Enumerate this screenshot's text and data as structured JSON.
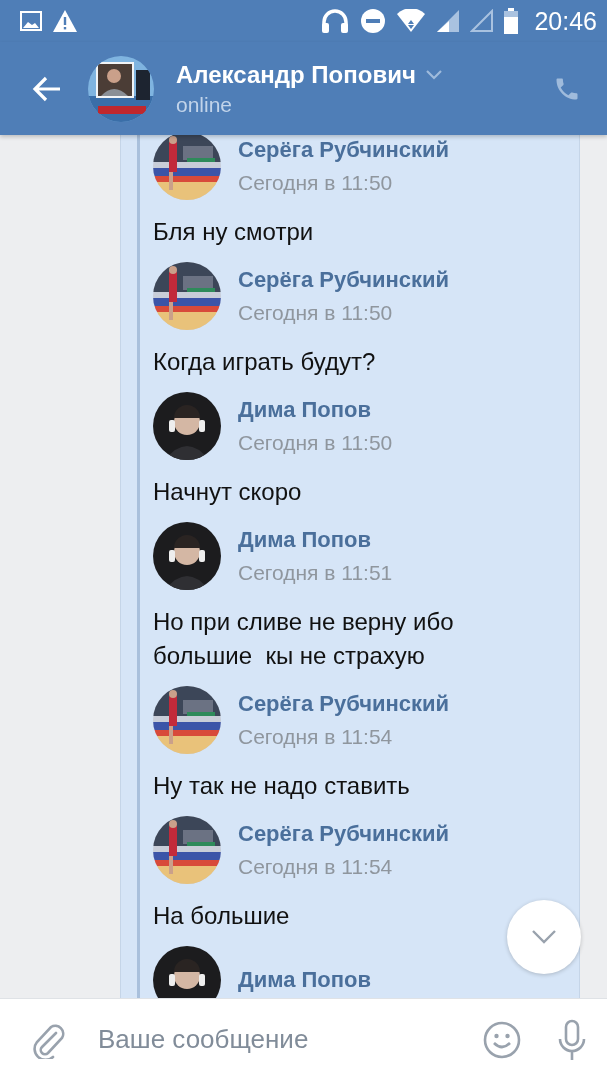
{
  "status_bar": {
    "time": "20:46"
  },
  "header": {
    "name": "Александр Попович",
    "status": "online"
  },
  "messages": [
    {
      "author": "Серёга Рубчинский",
      "time": "Сегодня в 11:50",
      "text": "Бля ну смотри"
    },
    {
      "author": "Серёга Рубчинский",
      "time": "Сегодня в 11:50",
      "text": "Когда играть будут?"
    },
    {
      "author": "Дима Попов",
      "time": "Сегодня в 11:50",
      "text": "Начнут скоро"
    },
    {
      "author": "Дима Попов",
      "time": "Сегодня в 11:51",
      "text": "Но при сливе не верну ибо большие  кы не страхую"
    },
    {
      "author": "Серёга Рубчинский",
      "time": "Сегодня в 11:54",
      "text": "Ну так не надо ставить"
    },
    {
      "author": "Серёга Рубчинский",
      "time": "Сегодня в 11:54",
      "text": "На большие"
    },
    {
      "author": "Дима Попов"
    }
  ],
  "composer": {
    "placeholder": "Ваше сообщение"
  }
}
